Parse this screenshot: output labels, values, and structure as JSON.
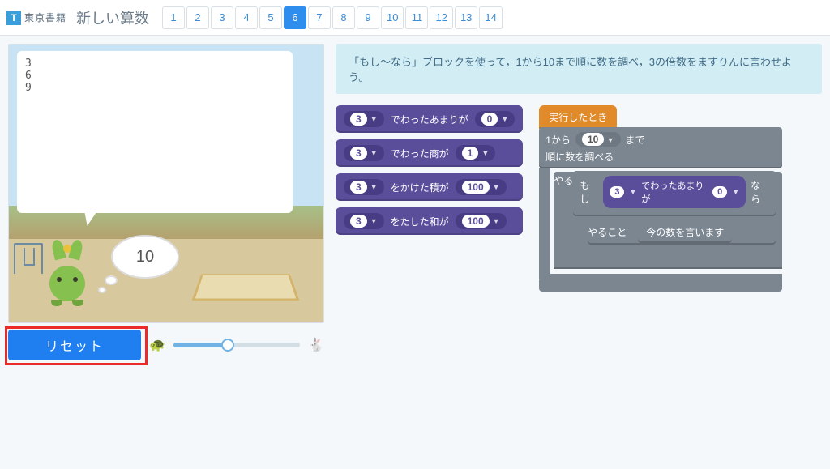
{
  "header": {
    "publisher": "東京書籍",
    "title": "新しい算数",
    "pages": [
      "1",
      "2",
      "3",
      "4",
      "5",
      "6",
      "7",
      "8",
      "9",
      "10",
      "11",
      "12",
      "13",
      "14"
    ],
    "active_page": "6"
  },
  "stage": {
    "output": "3\n6\n9",
    "thought": "10"
  },
  "controls": {
    "reset": "リセット"
  },
  "instruction": "「もし〜なら」ブロックを使って，1から10まで順に数を調べ，3の倍数をますりんに言わせよう。",
  "palette": {
    "blocks": [
      {
        "num": "3",
        "op": "でわったあまりが",
        "val": "0"
      },
      {
        "num": "3",
        "op": "でわった商が",
        "val": "1"
      },
      {
        "num": "3",
        "op": "をかけた積が",
        "val": "100"
      },
      {
        "num": "3",
        "op": "をたした和が",
        "val": "100"
      }
    ]
  },
  "workspace": {
    "hat": "実行したとき",
    "loop": {
      "from_label": "1から",
      "to_value": "10",
      "to_label": "まで",
      "desc": "順に数を調べる",
      "do_label": "やること"
    },
    "if": {
      "label": "もし",
      "cond_num": "3",
      "cond_op": "でわったあまりが",
      "cond_val": "0",
      "then": "なら",
      "do_label": "やること",
      "body": "今の数を言います"
    }
  }
}
